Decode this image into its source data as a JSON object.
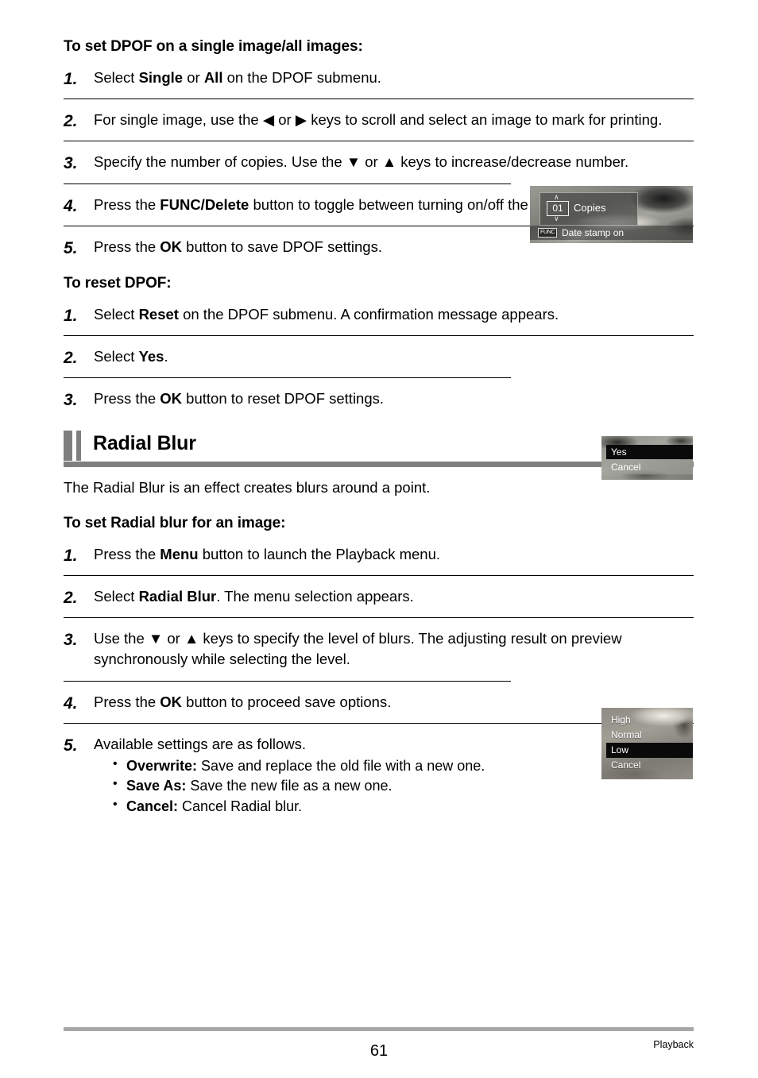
{
  "document": {
    "section_1": {
      "heading": "To set DPOF on a single image/all images:",
      "steps": [
        {
          "num": "1.",
          "parts": [
            {
              "t": "Select "
            },
            {
              "t": "Single",
              "b": true
            },
            {
              "t": " or "
            },
            {
              "t": "All",
              "b": true
            },
            {
              "t": " on the DPOF submenu."
            }
          ]
        },
        {
          "num": "2.",
          "parts": [
            {
              "t": "For single image, use the "
            },
            {
              "t": "◀",
              "icon": "left-arrow-key"
            },
            {
              "t": " or "
            },
            {
              "t": "▶",
              "icon": "right-arrow-key"
            },
            {
              "t": " keys to scroll and select an image to mark for printing."
            }
          ]
        },
        {
          "num": "3.",
          "parts": [
            {
              "t": "Specify the number of copies. Use the "
            },
            {
              "t": "▼",
              "icon": "down-arrow-key"
            },
            {
              "t": " or "
            },
            {
              "t": "▲",
              "icon": "up-arrow-key"
            },
            {
              "t": " keys to increase/decrease number."
            }
          ]
        },
        {
          "num": "4.",
          "parts": [
            {
              "t": "Press the "
            },
            {
              "t": "FUNC/Delete",
              "b": true
            },
            {
              "t": " button to toggle between turning on/off the date stamp."
            }
          ]
        },
        {
          "num": "5.",
          "parts": [
            {
              "t": "Press the "
            },
            {
              "t": "OK",
              "b": true
            },
            {
              "t": " button to save DPOF settings."
            }
          ]
        }
      ]
    },
    "section_2": {
      "heading": "To reset DPOF:",
      "steps": [
        {
          "num": "1.",
          "parts": [
            {
              "t": "Select "
            },
            {
              "t": "Reset",
              "b": true
            },
            {
              "t": " on the DPOF submenu. A confirmation message appears."
            }
          ]
        },
        {
          "num": "2.",
          "parts": [
            {
              "t": "Select "
            },
            {
              "t": "Yes",
              "b": true
            },
            {
              "t": "."
            }
          ]
        },
        {
          "num": "3.",
          "parts": [
            {
              "t": "Press the "
            },
            {
              "t": "OK",
              "b": true
            },
            {
              "t": " button to reset DPOF settings."
            }
          ]
        }
      ]
    },
    "section_3": {
      "title": "Radial Blur",
      "intro": "The Radial Blur is an effect creates blurs around a point.",
      "heading": "To set Radial blur for an image:",
      "steps": [
        {
          "num": "1.",
          "parts": [
            {
              "t": "Press the "
            },
            {
              "t": "Menu",
              "b": true
            },
            {
              "t": " button to launch the Playback menu."
            }
          ]
        },
        {
          "num": "2.",
          "parts": [
            {
              "t": "Select "
            },
            {
              "t": "Radial Blur",
              "b": true
            },
            {
              "t": ". The menu selection appears."
            }
          ]
        },
        {
          "num": "3.",
          "parts": [
            {
              "t": "Use the "
            },
            {
              "t": "▼",
              "icon": "down-arrow-key"
            },
            {
              "t": " or "
            },
            {
              "t": "▲",
              "icon": "up-arrow-key"
            },
            {
              "t": " keys to specify the level of blurs. The adjusting result on preview synchronously while selecting the level."
            }
          ]
        },
        {
          "num": "4.",
          "parts": [
            {
              "t": "Press the "
            },
            {
              "t": "OK",
              "b": true
            },
            {
              "t": " button to proceed save options."
            }
          ]
        },
        {
          "num": "5.",
          "parts": [
            {
              "t": "Available settings are as follows."
            }
          ]
        }
      ],
      "bullets": [
        {
          "label": "Overwrite:",
          "text": " Save and replace the old file with a new one."
        },
        {
          "label": "Save As:",
          "text": " Save the new file as a new one."
        },
        {
          "label": "Cancel:",
          "text": " Cancel Radial blur."
        }
      ]
    },
    "screenshots": {
      "copies": {
        "count": "01",
        "count_label": "Copies",
        "func_badge": "FUNC",
        "date_label": "Date stamp on",
        "chevron_up": "∧",
        "chevron_down": "∨"
      },
      "confirm": {
        "options": [
          "Yes",
          "Cancel"
        ],
        "selected_index": 0
      },
      "levels": {
        "options": [
          "High",
          "Normal",
          "Low",
          "Cancel"
        ],
        "selected_index": 2
      }
    },
    "footer": {
      "page_number": "61",
      "section_label": "Playback"
    },
    "colors": {
      "accent_gray": "#7f7f7f",
      "footer_rule": "#a8a8a8",
      "rule_black": "#000000"
    }
  }
}
